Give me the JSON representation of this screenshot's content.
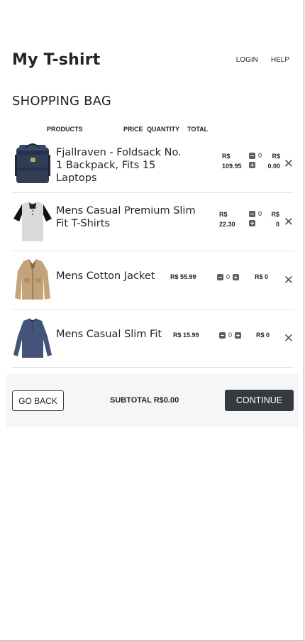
{
  "header": {
    "brand": "My T-shirt",
    "nav": [
      {
        "label": "LOGIN"
      },
      {
        "label": "HELP"
      }
    ]
  },
  "page_title": "SHOPPING BAG",
  "columns": {
    "products": "PRODUCTS",
    "price": "PRICE",
    "quantity": "QUANTITY",
    "total": "TOTAL"
  },
  "items": [
    {
      "name": "Fjallraven - Foldsack No. 1 Backpack, Fits 15 Laptops",
      "price_currency": "R$",
      "price_value": "109.95",
      "quantity": "0",
      "total_currency": "R$",
      "total_value": "0.00",
      "image": "backpack",
      "remove": "✕"
    },
    {
      "name": "Mens Casual Premium Slim Fit T-Shirts",
      "price_currency": "R$",
      "price_value": "22.30",
      "quantity": "0",
      "total_currency": "R$",
      "total_value": "0",
      "image": "tshirt",
      "remove": "✕"
    },
    {
      "name": "Mens Cotton Jacket",
      "price": "R$ 55.99",
      "quantity": "0",
      "total": "R$ 0",
      "image": "jacket",
      "remove": "✕"
    },
    {
      "name": "Mens Casual Slim Fit",
      "price": "R$ 15.99",
      "quantity": "0",
      "total": "R$ 0",
      "image": "longsleeve",
      "remove": "✕"
    }
  ],
  "footer": {
    "back_label": "GO BACK",
    "subtotal": "SUBTOTAL R$0.00",
    "continue_label": "CONTINUE"
  },
  "colors": {
    "dark_button": "#343a40",
    "footer_bg": "#f5f6f8",
    "divider": "#dee2e6"
  }
}
